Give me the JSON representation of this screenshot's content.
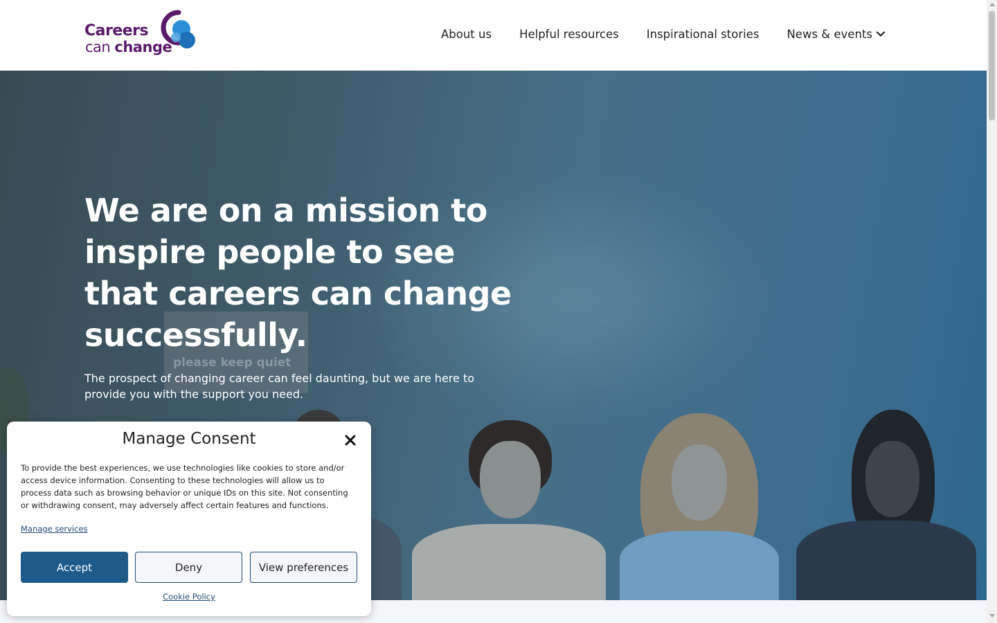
{
  "header": {
    "logo": {
      "line1": "Careers",
      "line2_prefix": "can",
      "line2_bold": "change"
    },
    "nav": [
      {
        "label": "About us"
      },
      {
        "label": "Helpful resources"
      },
      {
        "label": "Inspirational stories"
      },
      {
        "label": "News & events",
        "icon": "chevron-down-icon"
      }
    ]
  },
  "hero": {
    "title": "We are on a mission to inspire people to see that careers can change successfully.",
    "subtitle": "The prospect of changing career can feel daunting, but we are here to provide you with the support you need.",
    "background_sign_text": "please keep quiet"
  },
  "consent": {
    "title": "Manage Consent",
    "close_icon": "close-icon",
    "body": "To provide the best experiences, we use technologies like cookies to store and/or access device information. Consenting to these technologies will allow us to process data such as browsing behavior or unique IDs on this site. Not consenting or withdrawing consent, may adversely affect certain features and functions.",
    "manage_services": "Manage services",
    "accept": "Accept",
    "deny": "Deny",
    "view_preferences": "View preferences",
    "cookie_policy": "Cookie Policy"
  },
  "colors": {
    "brand_purple": "#5b1a6b",
    "brand_blue": "#2a8fd6",
    "accept_button": "#1e5a8a",
    "link": "#1e4a7a"
  }
}
